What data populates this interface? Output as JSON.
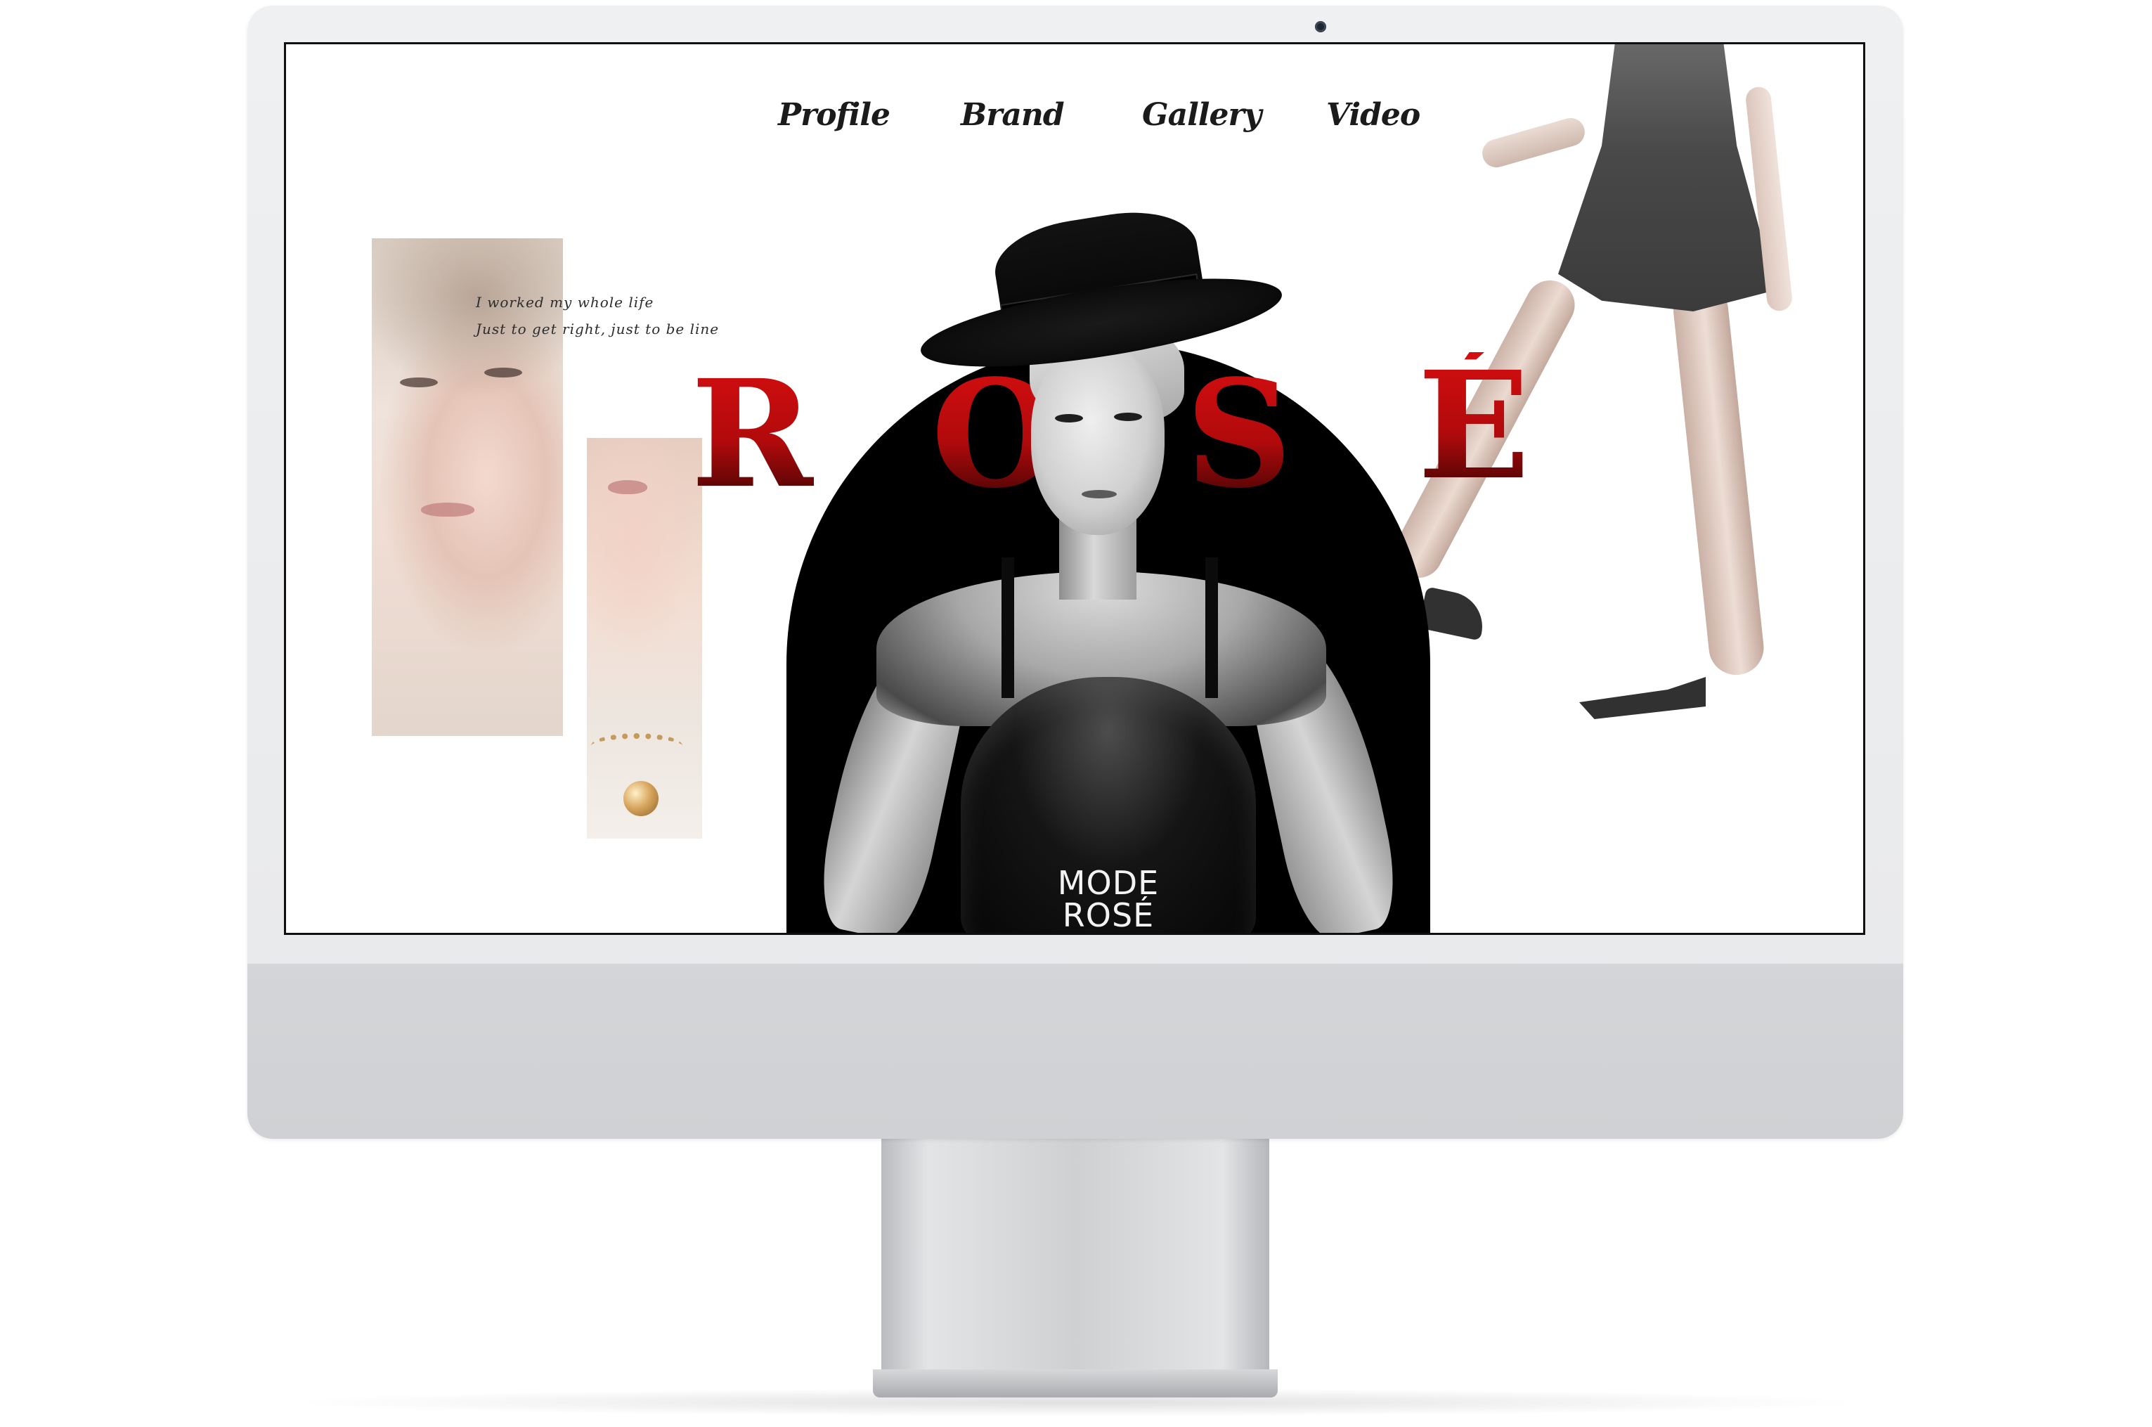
{
  "nav": {
    "items": [
      {
        "label": "Profile"
      },
      {
        "label": "Brand"
      },
      {
        "label": "Gallery"
      },
      {
        "label": "Video"
      }
    ]
  },
  "hero": {
    "letters": [
      "R",
      "O",
      "S",
      "É"
    ],
    "quote_line1": "I worked my whole life",
    "quote_line2": "Just to get right, just to be line",
    "badge_line1": "MODE",
    "badge_line2": "ROSÉ"
  },
  "colors": {
    "accent": "#c00b0e",
    "arch": "#000000",
    "frame": "#eef0f2"
  },
  "icons": {
    "camera": "camera-icon"
  }
}
